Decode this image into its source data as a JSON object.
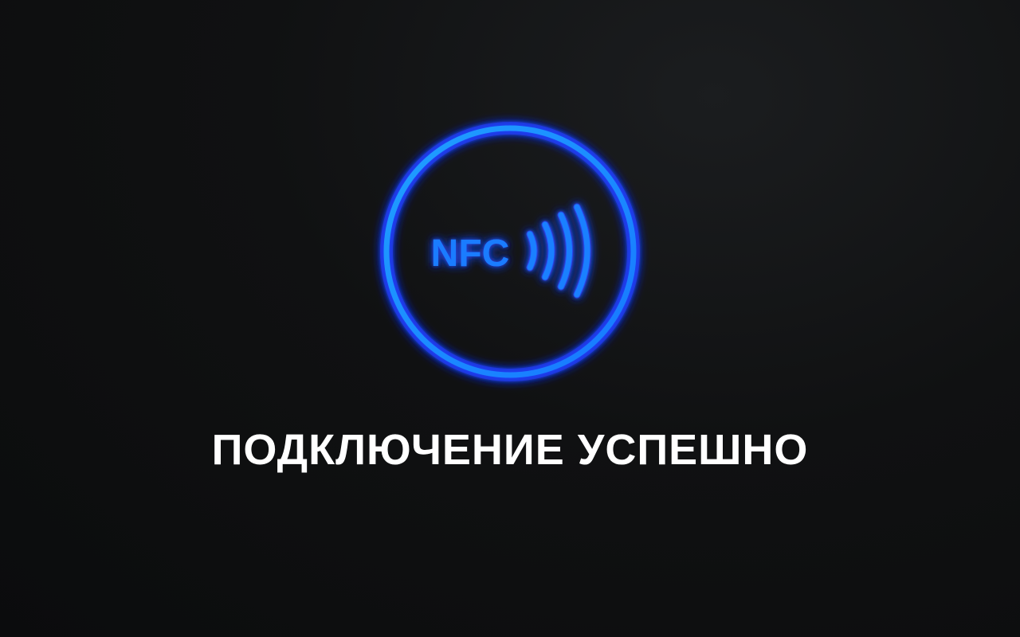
{
  "nfc_badge": {
    "label": "NFC",
    "icon": "nfc-icon",
    "accent_color": "#1a8cff",
    "glow_color": "#2a4dff"
  },
  "status": {
    "message": "ПОДКЛЮЧЕНИЕ УСПЕШНО",
    "color": "#ffffff"
  }
}
